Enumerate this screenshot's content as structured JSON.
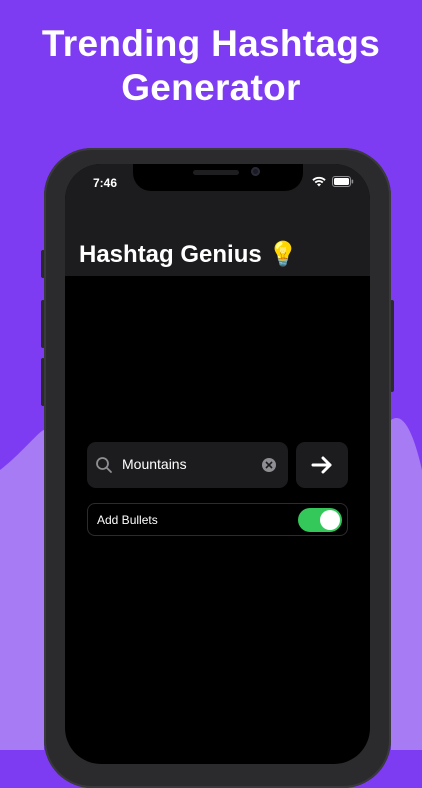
{
  "headline": {
    "line1": "Trending Hashtags",
    "line2": "Generator"
  },
  "status_bar": {
    "time": "7:46",
    "icons": [
      "wifi-icon",
      "battery-icon"
    ]
  },
  "nav": {
    "title": "Hashtag Genius 💡"
  },
  "search": {
    "value": "Mountains",
    "icon": "search-icon",
    "clear_icon": "clear-icon"
  },
  "go_button": {
    "icon": "arrow-right-icon"
  },
  "options": {
    "add_bullets_label": "Add Bullets",
    "add_bullets_on": true
  },
  "colors": {
    "background": "#7d3cf2",
    "background_lower": "#a77bf4",
    "toggle_on": "#34c759"
  }
}
